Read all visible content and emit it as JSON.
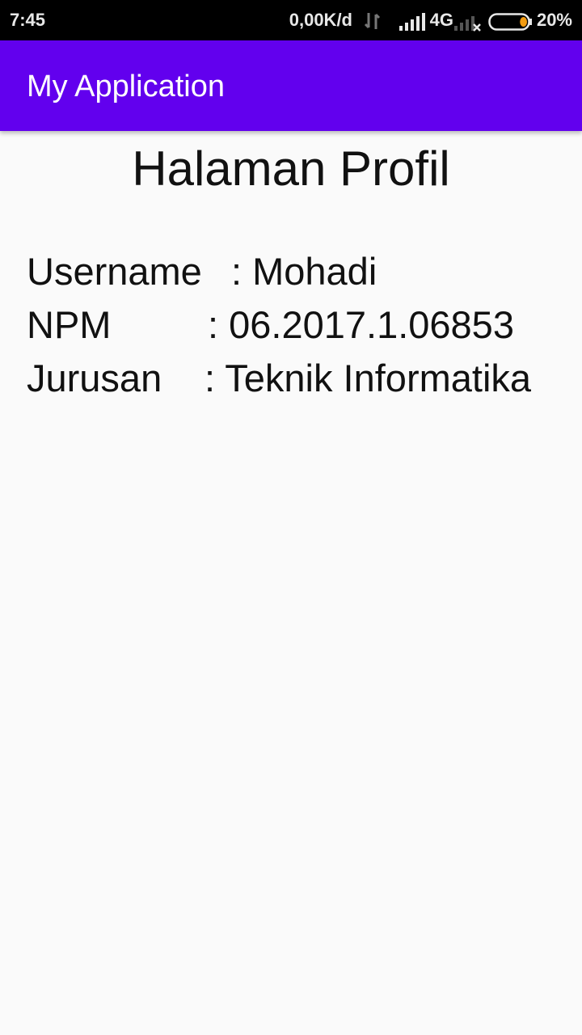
{
  "status_bar": {
    "time": "7:45",
    "net_speed": "0,00K/d",
    "network_type": "4G",
    "battery_percent": "20%",
    "battery_level": 0.2,
    "accent_color": "#f39c12"
  },
  "app_bar": {
    "title": "My Application",
    "color": "#6200ee"
  },
  "profile": {
    "page_title": "Halaman Profil",
    "fields": [
      {
        "label": "Username",
        "value": ": Mohadi"
      },
      {
        "label": "NPM",
        "value": ": 06.2017.1.06853"
      },
      {
        "label": "Jurusan",
        "value": ": Teknik Informatika"
      }
    ]
  }
}
